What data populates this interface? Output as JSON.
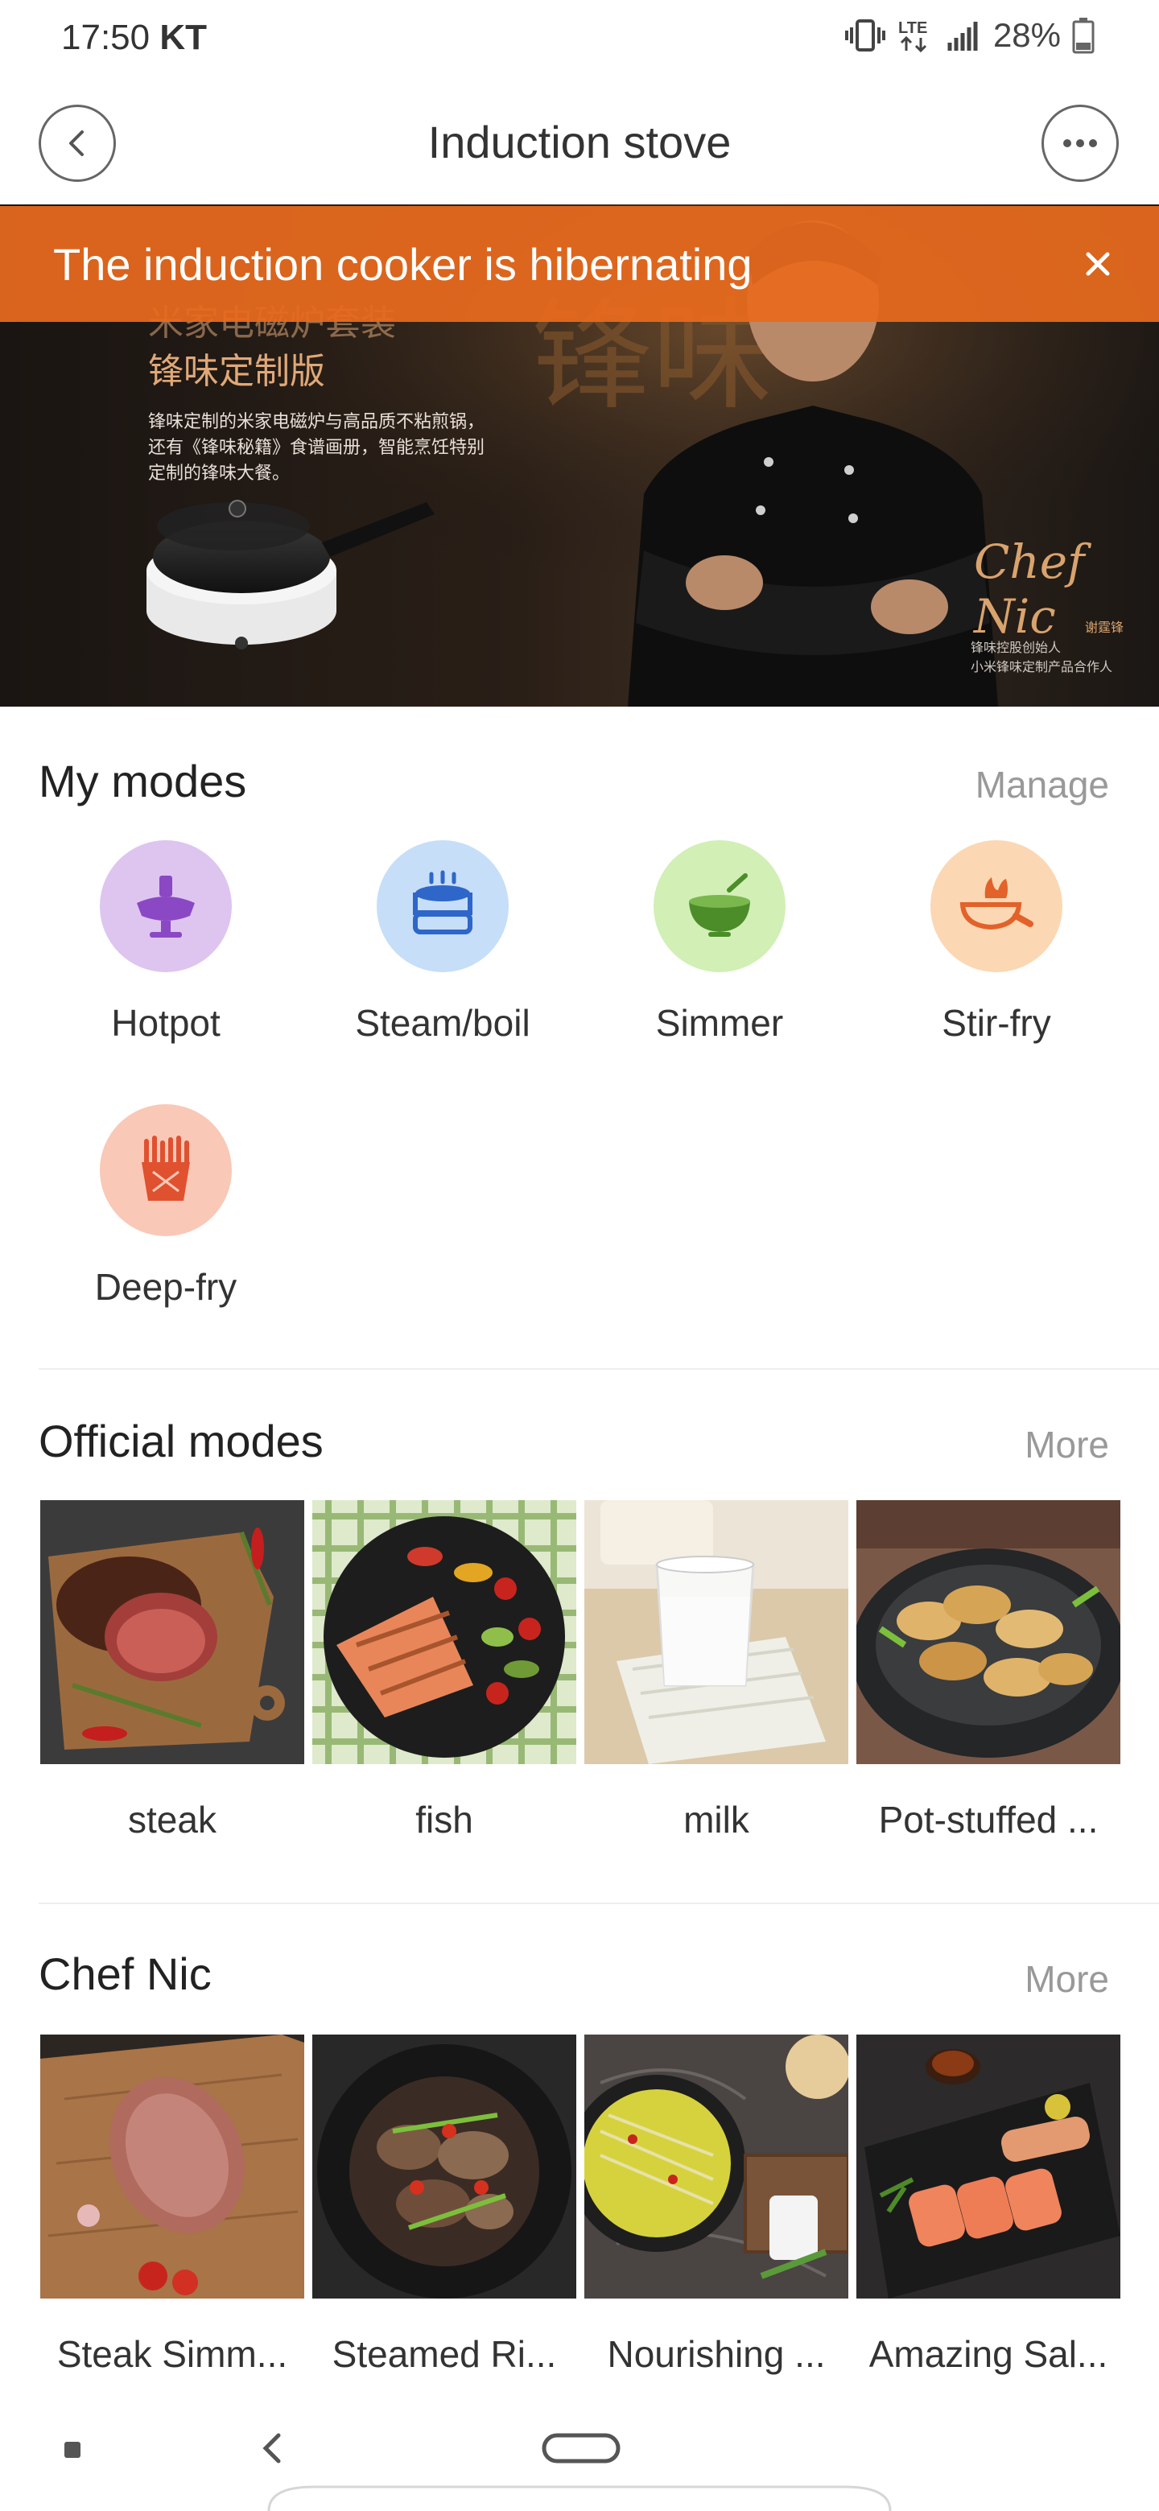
{
  "status_bar": {
    "time": "17:50",
    "carrier": "KT",
    "battery": "28%"
  },
  "header": {
    "title": "Induction stove"
  },
  "notice": {
    "text": "The induction cooker is hibernating"
  },
  "banner": {
    "headline_line1": "米家电磁炉套装",
    "headline_line2": "锋味定制版",
    "desc_line1": "锋味定制的米家电磁炉与高品质不粘煎锅，",
    "desc_line2": "还有《锋味秘籍》食谱画册，智能烹饪特别",
    "desc_line3": "定制的锋味大餐。",
    "brand_chars": "锋味",
    "signature": "Chef Nic",
    "signature_name": "谢霆锋",
    "credit_line1": "锋味控股创始人",
    "credit_line2": "小米锋味定制产品合作人"
  },
  "my_modes": {
    "title": "My modes",
    "action": "Manage",
    "items": [
      {
        "label": "Hotpot",
        "icon": "hotpot-icon",
        "bg": "#ddc5f0",
        "fg": "#8b48c4"
      },
      {
        "label": "Steam/boil",
        "icon": "steamer-icon",
        "bg": "#c6def8",
        "fg": "#2f66c9"
      },
      {
        "label": "Simmer",
        "icon": "simmer-bowl-icon",
        "bg": "#d2efb6",
        "fg": "#4c8d2a"
      },
      {
        "label": "Stir-fry",
        "icon": "stir-fry-pan-icon",
        "bg": "#fbd7b3",
        "fg": "#e2622a"
      },
      {
        "label": "Deep-fry",
        "icon": "deep-fry-icon",
        "bg": "#f9c8b7",
        "fg": "#e0512f"
      }
    ]
  },
  "official_modes": {
    "title": "Official modes",
    "action": "More",
    "items": [
      {
        "label": "steak"
      },
      {
        "label": "fish"
      },
      {
        "label": "milk"
      },
      {
        "label": "Pot-stuffed ..."
      }
    ]
  },
  "chef_nic": {
    "title": "Chef Nic",
    "action": "More",
    "items": [
      {
        "label": "Steak Simm..."
      },
      {
        "label": "Steamed Ri..."
      },
      {
        "label": "Nourishing ..."
      },
      {
        "label": "Amazing Sal..."
      }
    ]
  }
}
